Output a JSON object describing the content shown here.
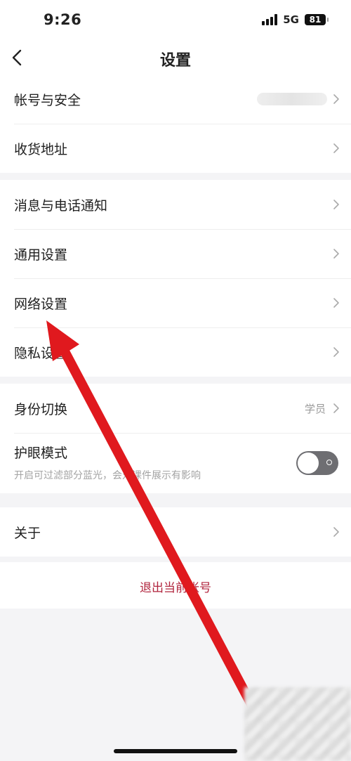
{
  "status_bar": {
    "time": "9:26",
    "network": "5G",
    "battery": "81"
  },
  "header": {
    "title": "设置"
  },
  "groups": [
    {
      "items": [
        {
          "label": "帐号与安全",
          "value": ""
        },
        {
          "label": "收货地址"
        }
      ]
    },
    {
      "items": [
        {
          "label": "消息与电话通知"
        },
        {
          "label": "通用设置"
        },
        {
          "label": "网络设置"
        },
        {
          "label": "隐私设置"
        }
      ]
    },
    {
      "items": [
        {
          "label": "身份切换",
          "value": "学员"
        },
        {
          "label": "护眼模式",
          "subtitle": "开启可过滤部分蓝光，会对课件展示有影响",
          "toggle_on": false
        }
      ]
    },
    {
      "items": [
        {
          "label": "关于"
        }
      ]
    }
  ],
  "logout": {
    "label": "退出当前帐号",
    "color": "#b1253e"
  },
  "annotation": {
    "arrow_color": "#e0191e"
  },
  "icons": {
    "back": "chevron-left-icon",
    "row_arrow": "chevron-right-icon"
  }
}
